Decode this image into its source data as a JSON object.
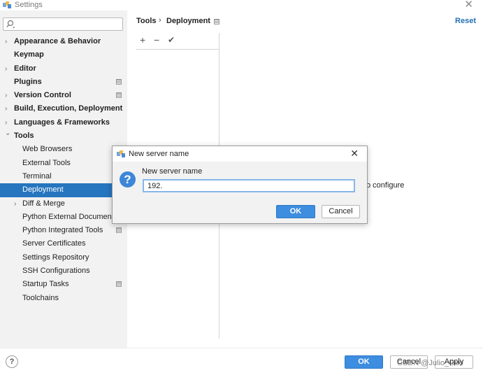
{
  "window": {
    "title": "Settings"
  },
  "sidebar": {
    "search_placeholder": "",
    "items": [
      {
        "label": "Appearance & Behavior",
        "bold": true,
        "expandable": true,
        "expanded": false,
        "level": 0,
        "project_icon": false
      },
      {
        "label": "Keymap",
        "bold": true,
        "expandable": false,
        "level": 0,
        "project_icon": false
      },
      {
        "label": "Editor",
        "bold": true,
        "expandable": true,
        "expanded": false,
        "level": 0,
        "project_icon": false
      },
      {
        "label": "Plugins",
        "bold": true,
        "expandable": false,
        "level": 0,
        "project_icon": true
      },
      {
        "label": "Version Control",
        "bold": true,
        "expandable": true,
        "expanded": false,
        "level": 0,
        "project_icon": true
      },
      {
        "label": "Build, Execution, Deployment",
        "bold": true,
        "expandable": true,
        "expanded": false,
        "level": 0,
        "project_icon": false
      },
      {
        "label": "Languages & Frameworks",
        "bold": true,
        "expandable": true,
        "expanded": false,
        "level": 0,
        "project_icon": false
      },
      {
        "label": "Tools",
        "bold": true,
        "expandable": true,
        "expanded": true,
        "level": 0,
        "project_icon": false
      },
      {
        "label": "Web Browsers",
        "bold": false,
        "expandable": false,
        "level": 1,
        "project_icon": false
      },
      {
        "label": "External Tools",
        "bold": false,
        "expandable": false,
        "level": 1,
        "project_icon": false
      },
      {
        "label": "Terminal",
        "bold": false,
        "expandable": false,
        "level": 1,
        "project_icon": false
      },
      {
        "label": "Deployment",
        "bold": false,
        "expandable": false,
        "level": 1,
        "project_icon": false,
        "selected": true
      },
      {
        "label": "Diff & Merge",
        "bold": false,
        "expandable": true,
        "expanded": false,
        "level": 1,
        "project_icon": false
      },
      {
        "label": "Python External Documentat",
        "bold": false,
        "expandable": false,
        "level": 1,
        "project_icon": false
      },
      {
        "label": "Python Integrated Tools",
        "bold": false,
        "expandable": false,
        "level": 1,
        "project_icon": true
      },
      {
        "label": "Server Certificates",
        "bold": false,
        "expandable": false,
        "level": 1,
        "project_icon": false
      },
      {
        "label": "Settings Repository",
        "bold": false,
        "expandable": false,
        "level": 1,
        "project_icon": false
      },
      {
        "label": "SSH Configurations",
        "bold": false,
        "expandable": false,
        "level": 1,
        "project_icon": false
      },
      {
        "label": "Startup Tasks",
        "bold": false,
        "expandable": false,
        "level": 1,
        "project_icon": true
      },
      {
        "label": "Toolchains",
        "bold": false,
        "expandable": false,
        "level": 1,
        "project_icon": false
      }
    ]
  },
  "main": {
    "breadcrumb": [
      "Tools",
      "Deployment"
    ],
    "breadcrumb_sep": "›",
    "reset_label": "Reset",
    "toolbar": {
      "add": "+",
      "remove": "−",
      "apply": "✔"
    },
    "hint_text": "o configure"
  },
  "dialog": {
    "title": "New server name",
    "close": "✕",
    "label": "New server name",
    "input_value": "192.",
    "ok_label": "OK",
    "cancel_label": "Cancel",
    "question_icon": "?"
  },
  "bottom": {
    "help_label": "?",
    "ok_label": "OK",
    "cancel_label": "Cancel",
    "apply_label": "Apply"
  },
  "watermark": "CSDN @Julio_Guo",
  "colors": {
    "selection": "#2675bf",
    "primary_button": "#3d8de0",
    "link": "#2470b3",
    "sidebar_bg": "#f2f2f2"
  }
}
